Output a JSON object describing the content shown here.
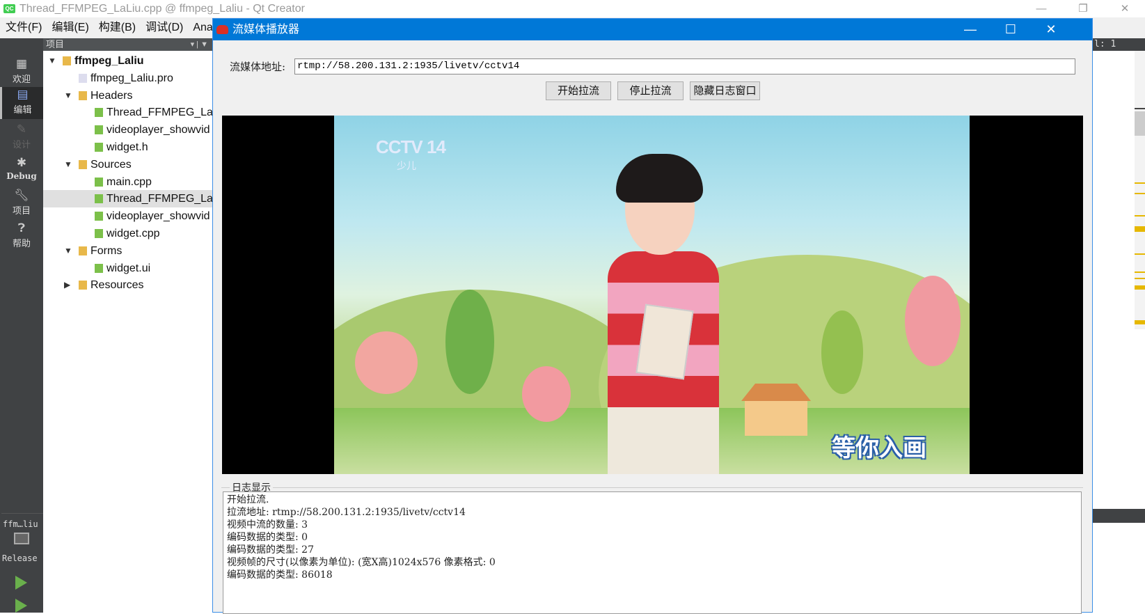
{
  "qt": {
    "title": "Thread_FFMPEG_LaLiu.cpp @ ffmpeg_Laliu - Qt Creator",
    "logo": "QC",
    "menu": [
      "文件(F)",
      "编辑(E)",
      "构建(B)",
      "调试(D)",
      "Analy"
    ],
    "modes": [
      {
        "label": "欢迎",
        "icon": "grid-icon"
      },
      {
        "label": "编辑",
        "icon": "document-icon"
      },
      {
        "label": "设计",
        "icon": "pencil-icon"
      },
      {
        "label": "Debug",
        "icon": "bug-icon"
      },
      {
        "label": "项目",
        "icon": "wrench-icon"
      },
      {
        "label": "帮助",
        "icon": "help-icon"
      }
    ],
    "kit": {
      "project": "ffm…liu",
      "config": "Release"
    },
    "tree_header": "项目",
    "tree": [
      {
        "label": "ffmpeg_Laliu",
        "level": 0,
        "expanded": true,
        "bold": true
      },
      {
        "label": "ffmpeg_Laliu.pro",
        "level": 1
      },
      {
        "label": "Headers",
        "level": 1,
        "expanded": true,
        "folder": true
      },
      {
        "label": "Thread_FFMPEG_LaL",
        "level": 2
      },
      {
        "label": "videoplayer_showvid",
        "level": 2
      },
      {
        "label": "widget.h",
        "level": 2
      },
      {
        "label": "Sources",
        "level": 1,
        "expanded": true,
        "folder": true
      },
      {
        "label": "main.cpp",
        "level": 2
      },
      {
        "label": "Thread_FFMPEG_LaL",
        "level": 2,
        "selected": true
      },
      {
        "label": "videoplayer_showvid",
        "level": 2
      },
      {
        "label": "widget.cpp",
        "level": 2
      },
      {
        "label": "Forms",
        "level": 1,
        "expanded": true,
        "folder": true
      },
      {
        "label": "widget.ui",
        "level": 2
      },
      {
        "label": "Resources",
        "level": 1,
        "expanded": false,
        "folder": true
      }
    ],
    "cursor_pos": "l: 1"
  },
  "dialog": {
    "title": "流媒体播放器",
    "address_label": "流媒体地址:",
    "address_value": "rtmp://58.200.131.2:1935/livetv/cctv14",
    "buttons": {
      "start": "开始拉流",
      "stop": "停止拉流",
      "hide_log": "隐藏日志窗口"
    },
    "video": {
      "channel_logo": "CCTV 14",
      "channel_sub": "少儿",
      "caption": "等你入画"
    },
    "log_label": "日志显示",
    "log_lines": [
      "开始拉流.",
      "拉流地址: rtmp://58.200.131.2:1935/livetv/cctv14",
      "视频中流的数量: 3",
      "编码数据的类型: 0",
      "编码数据的类型: 27",
      "视频帧的尺寸(以像素为单位): (宽X高)1024x576 像素格式: 0",
      "编码数据的类型: 86018"
    ]
  },
  "colors": {
    "accent": "#0078d7",
    "modebar": "#404244"
  }
}
